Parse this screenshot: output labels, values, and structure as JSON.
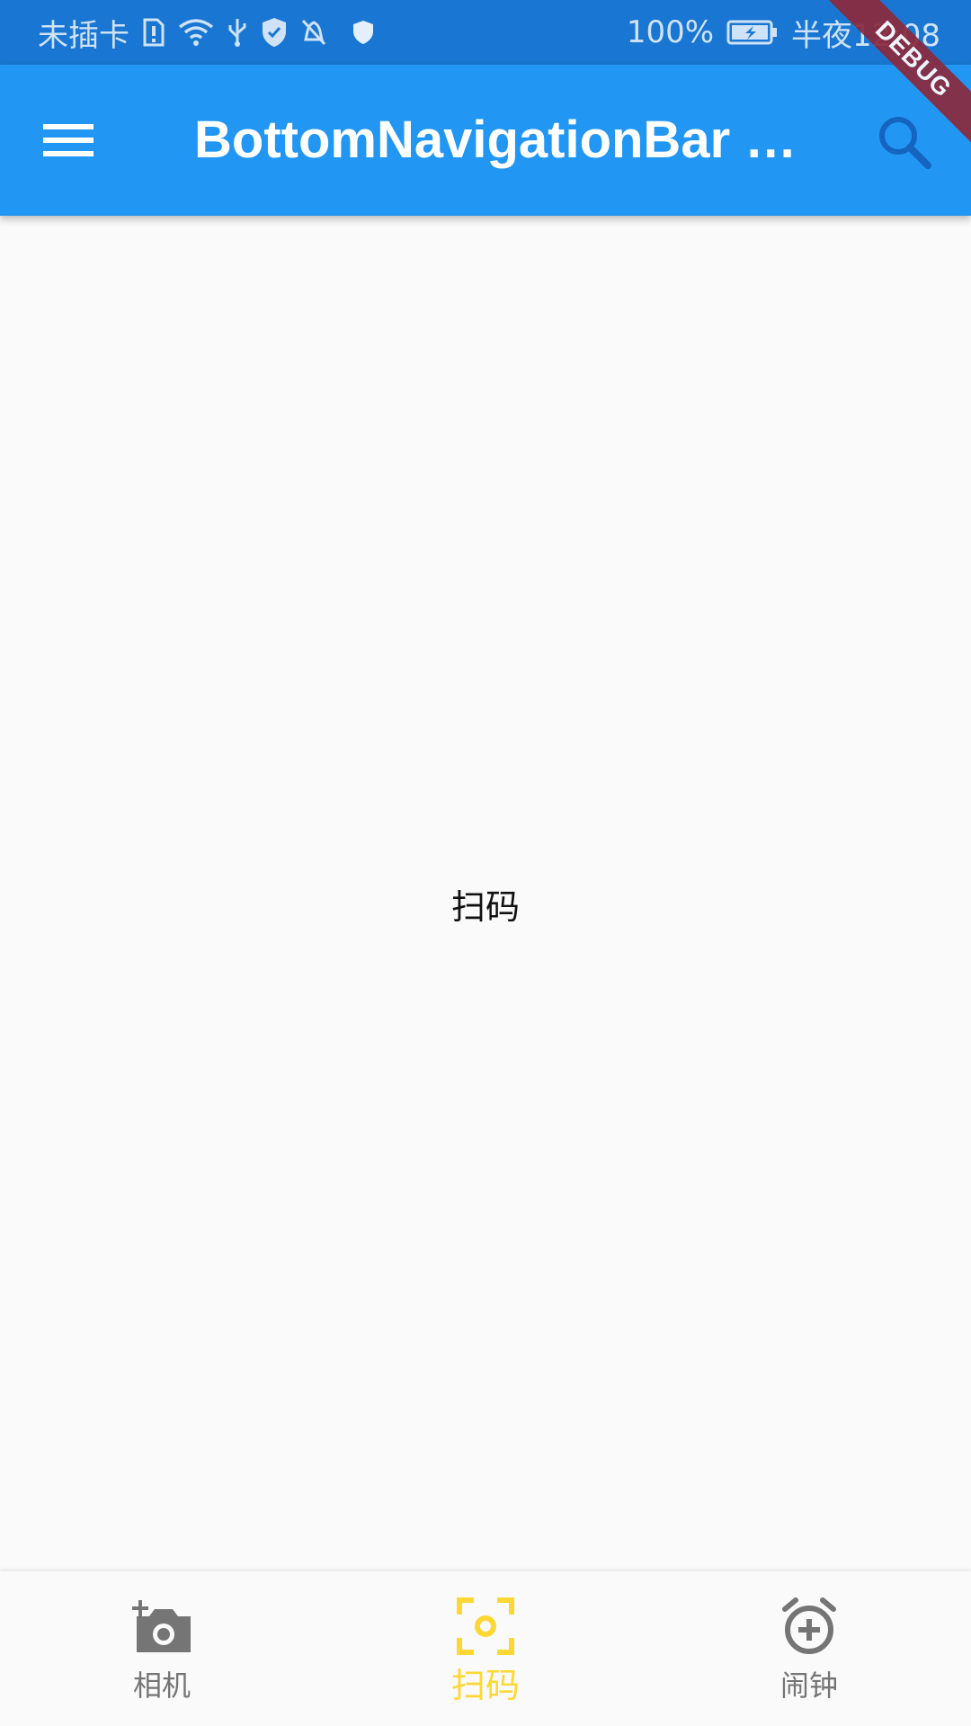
{
  "status_bar": {
    "carrier": "未插卡",
    "battery": "100%",
    "time": "半夜12:08",
    "icons": [
      "sim-alert-icon",
      "wifi-icon",
      "usb-icon",
      "shield-check-icon",
      "notification-off-icon",
      "vpn-shield-icon",
      "battery-charging-icon"
    ]
  },
  "app_bar": {
    "title": "BottomNavigationBar …",
    "debug_banner": "DEBUG"
  },
  "content": {
    "text": "扫码"
  },
  "bottom_nav": {
    "active_index": 1,
    "active_color": "#fdd835",
    "inactive_color": "#757575",
    "items": [
      {
        "label": "相机",
        "icon": "add-camera-icon"
      },
      {
        "label": "扫码",
        "icon": "scan-icon"
      },
      {
        "label": "闹钟",
        "icon": "add-alarm-icon"
      }
    ]
  },
  "colors": {
    "app_bar": "#2196f3",
    "status_bar": "#1976d2",
    "background": "#fafafa"
  }
}
